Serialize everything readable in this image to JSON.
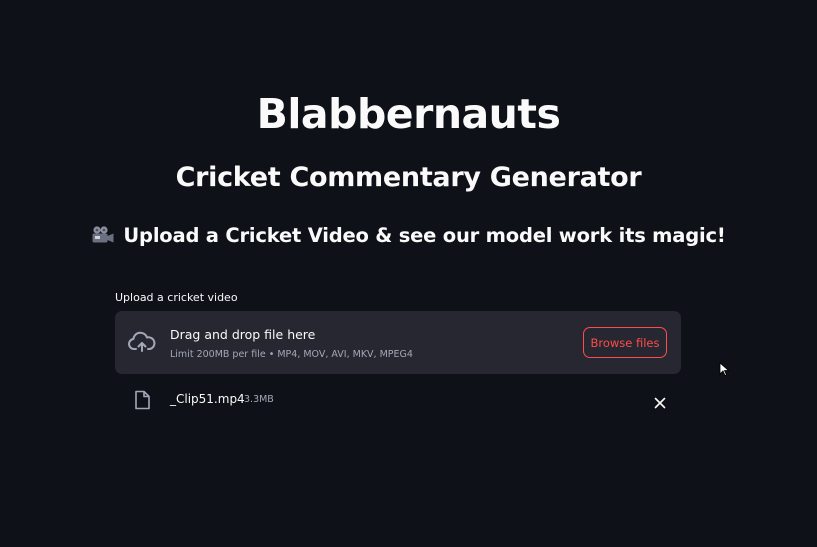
{
  "header": {
    "title": "Blabbernauts",
    "subtitle": "Cricket Commentary Generator",
    "tagline": "Upload a Cricket Video & see our model work its magic!",
    "tagline_icon": "movie-camera-icon"
  },
  "uploader": {
    "label": "Upload a cricket video",
    "drop_title": "Drag and drop file here",
    "limit_text": "Limit 200MB per file • MP4, MOV, AVI, MKV, MPEG4",
    "browse_label": "Browse files",
    "icon": "cloud-upload-icon"
  },
  "file": {
    "name": "_Clip51.mp4",
    "size": "3.3MB",
    "icon": "file-icon",
    "remove_icon": "close-icon"
  },
  "colors": {
    "background": "#0e1117",
    "dropzone": "#262730",
    "accent": "#ff4b4b",
    "text": "#fafafa",
    "muted": "#a3a8b8"
  }
}
